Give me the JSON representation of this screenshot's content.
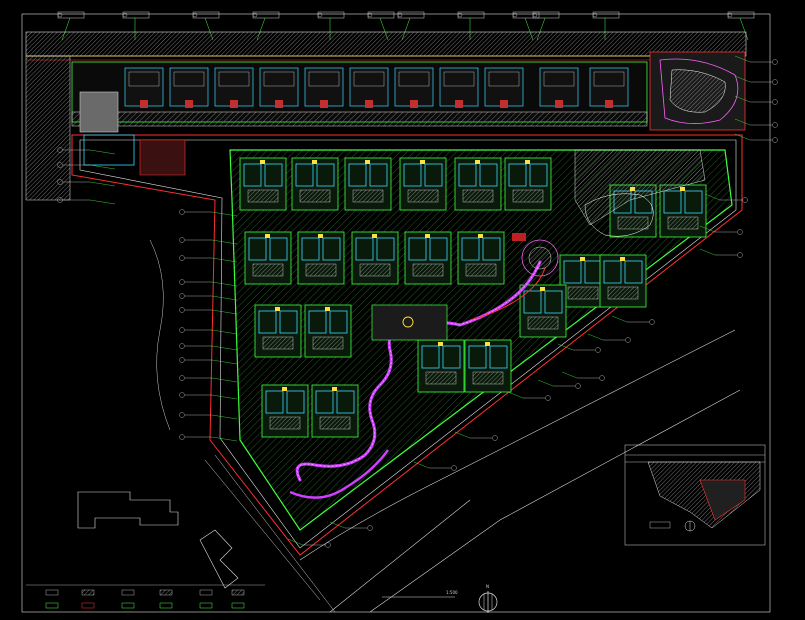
{
  "drawing": {
    "main_title": "",
    "scale_label": "1:500",
    "north_label": "N",
    "inset_label": ""
  },
  "colors": {
    "background": "#000000",
    "boundary_green": "#3cff3c",
    "road_white": "#e8e8e8",
    "building_cyan": "#3ad6ff",
    "path_magenta": "#d040ff",
    "red_line": "#ff3030",
    "yellow": "#ffe040",
    "hatch_gray": "#8a8a8a"
  },
  "icons": {
    "north_arrow": "north-arrow-icon",
    "callout": "callout-bubble-icon"
  }
}
